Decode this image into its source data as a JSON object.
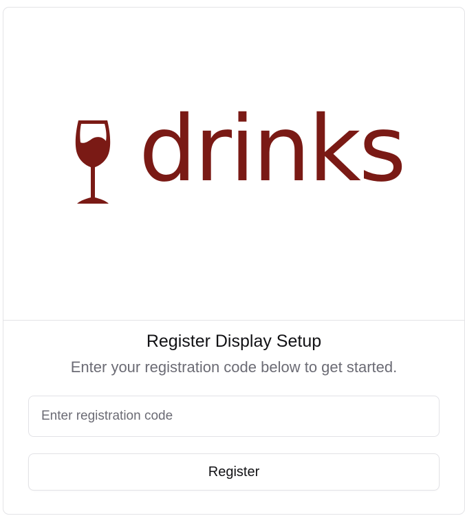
{
  "brand": {
    "logo_text": "drinks",
    "logo_icon": "wine-glass-icon",
    "color": "#7a1a15"
  },
  "setup": {
    "title": "Register Display Setup",
    "subtitle": "Enter your registration code below to get started."
  },
  "form": {
    "code_placeholder": "Enter registration code",
    "code_value": "",
    "register_label": "Register"
  }
}
